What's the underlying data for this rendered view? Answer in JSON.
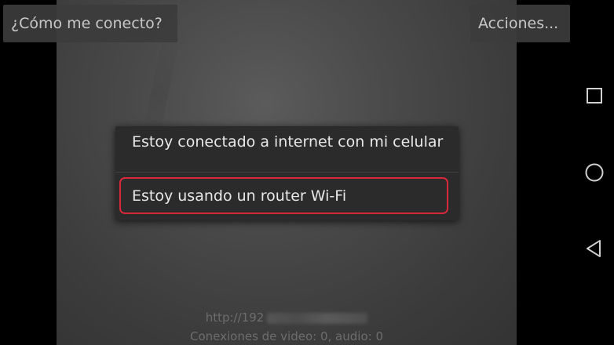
{
  "toolbar": {
    "connect_label": "¿Cómo me conecto?",
    "actions_label": "Acciones..."
  },
  "menu": {
    "items": [
      {
        "label": "Estoy conectado a internet con mi celular"
      },
      {
        "label": "Estoy usando un router Wi-Fi"
      }
    ]
  },
  "status": {
    "url_prefix": "http://192",
    "connections": "Conexiones de video: 0, audio: 0"
  },
  "highlight": {
    "color": "#d8283a"
  },
  "nav": {
    "recents_icon": "square-icon",
    "home_icon": "circle-icon",
    "back_icon": "triangle-back-icon"
  }
}
